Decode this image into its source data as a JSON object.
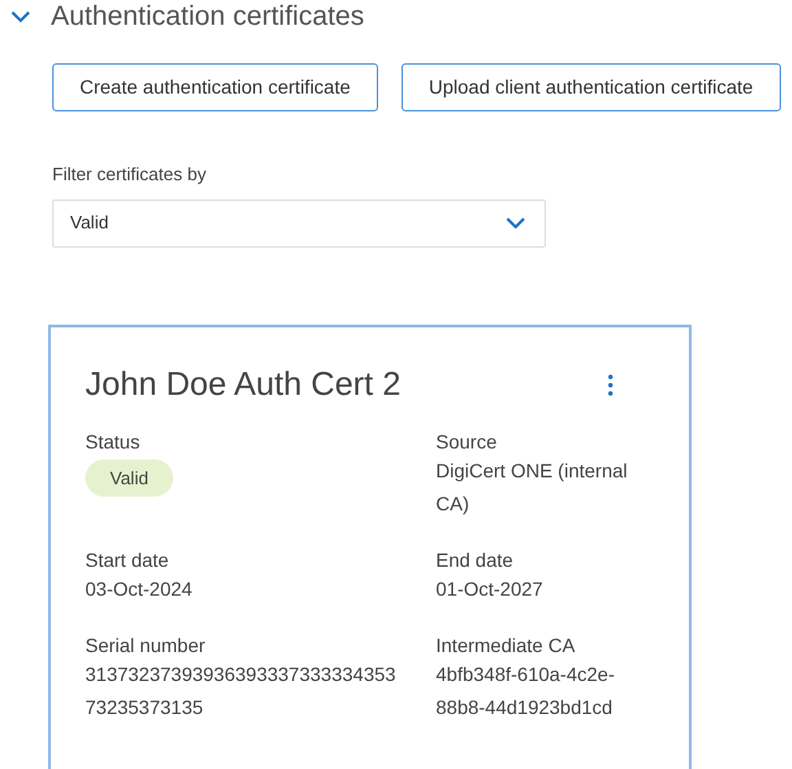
{
  "section": {
    "title": "Authentication certificates",
    "expanded": true
  },
  "buttons": [
    "Create authentication certificate",
    "Upload client authentication certificate"
  ],
  "filter": {
    "label": "Filter certificates by",
    "value": "Valid"
  },
  "certificate": {
    "name": "John Doe Auth Cert 2",
    "status_label": "Status",
    "status": {
      "text": "Valid",
      "color": "#e6f2cf"
    },
    "left_fields": [
      {
        "label": "Start date",
        "value": "03-Oct-2024"
      },
      {
        "label": "Serial number",
        "value": "3137323739393639333733333435373235373135"
      }
    ],
    "right_fields": [
      {
        "label": "Source",
        "value": "DigiCert ONE (internal CA)"
      },
      {
        "label": "End date",
        "value": "01-Oct-2027"
      },
      {
        "label": "Intermediate CA",
        "value": "4bfb348f-610a-4c2e-88b8-44d1923bd1cd"
      }
    ]
  }
}
